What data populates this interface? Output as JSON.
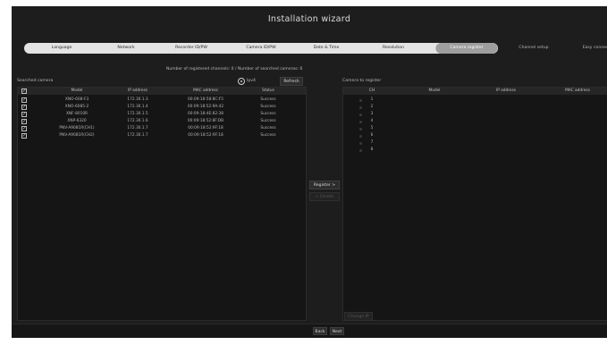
{
  "window": {
    "title": "Installation wizard"
  },
  "steps": [
    {
      "label": "Language",
      "state": "normal"
    },
    {
      "label": "Network",
      "state": "normal"
    },
    {
      "label": "Recorder ID/PW",
      "state": "normal"
    },
    {
      "label": "Camera ID/PW",
      "state": "normal"
    },
    {
      "label": "Date & Time",
      "state": "normal"
    },
    {
      "label": "Resolution",
      "state": "normal"
    },
    {
      "label": "Camera register",
      "state": "active"
    },
    {
      "label": "Channel setup",
      "state": "upcoming"
    },
    {
      "label": "Easy connect",
      "state": "upcoming"
    }
  ],
  "counts_text": "Number of registered channels: 0 / Number of searched cameras: 6",
  "searched": {
    "title": "Searched camera",
    "filter_label": "Ipv4",
    "refresh_label": "Refresh",
    "columns": [
      "Model",
      "IP address",
      "MAC address",
      "Status"
    ],
    "rows": [
      {
        "model": "XNO-608-F3",
        "ip": "172.30.1.3",
        "mac": "00:09:18:58:8C:F5",
        "status": "Success",
        "checked": true
      },
      {
        "model": "XNO-6085-2",
        "ip": "172.30.1.4",
        "mac": "00:09:18:52:9A:42",
        "status": "Success",
        "checked": true
      },
      {
        "model": "XNF-8010R",
        "ip": "172.30.1.5",
        "mac": "00:09:18:4E:82:38",
        "status": "Success",
        "checked": true
      },
      {
        "model": "XNP-6320",
        "ip": "172.30.1.6",
        "mac": "00:09:18:52:8F:DB",
        "status": "Success",
        "checked": true
      },
      {
        "model": "PNV-A9081R(CH1)",
        "ip": "172.30.1.7",
        "mac": "00:09:18:52:9F:18",
        "status": "Success",
        "checked": true
      },
      {
        "model": "PNV-A9081R(CH2)",
        "ip": "172.30.1.7",
        "mac": "00:09:18:52:9F:18",
        "status": "Success",
        "checked": true
      }
    ]
  },
  "register_btn": "Register >",
  "unregister_btn": "< Delete",
  "target": {
    "title": "Camera to register",
    "columns": [
      "CH",
      "Model",
      "IP address",
      "MAC address"
    ],
    "channels": [
      "1",
      "2",
      "3",
      "4",
      "5",
      "6",
      "7",
      "8"
    ]
  },
  "change_ip_btn": "Change IP",
  "nav": {
    "back": "Back",
    "next": "Next"
  }
}
